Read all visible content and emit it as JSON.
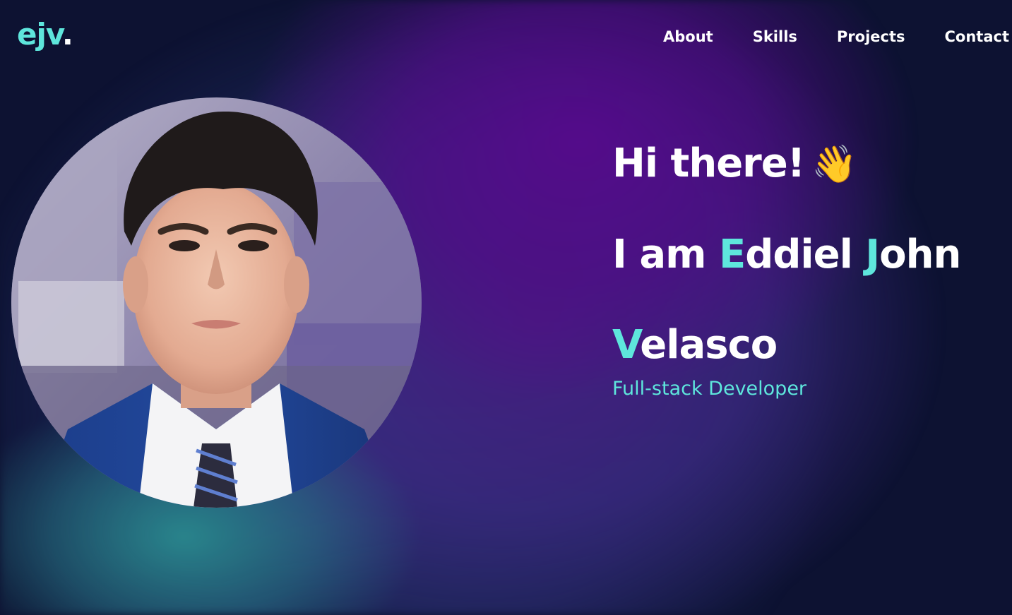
{
  "logo": {
    "text": "ejv",
    "dot": "."
  },
  "nav": {
    "items": [
      {
        "label": "About"
      },
      {
        "label": "Skills"
      },
      {
        "label": "Projects"
      },
      {
        "label": "Contact"
      }
    ]
  },
  "hero": {
    "greeting": "Hi there!",
    "wave_emoji": "👋",
    "name_line1": {
      "prefix": "I am ",
      "first_initial": "E",
      "first_rest": "ddiel ",
      "middle_initial": "J",
      "middle_rest": "ohn"
    },
    "name_line2": {
      "last_initial": "V",
      "last_rest": "elasco"
    },
    "role": "Full-stack Developer"
  },
  "colors": {
    "background": "#0d1232",
    "accent": "#5ee6dc",
    "text": "#ffffff",
    "purple": "#560a8c",
    "teal_glow": "#2c9696"
  },
  "icons": {
    "wave": "waving-hand-icon",
    "portrait": "profile-photo"
  }
}
